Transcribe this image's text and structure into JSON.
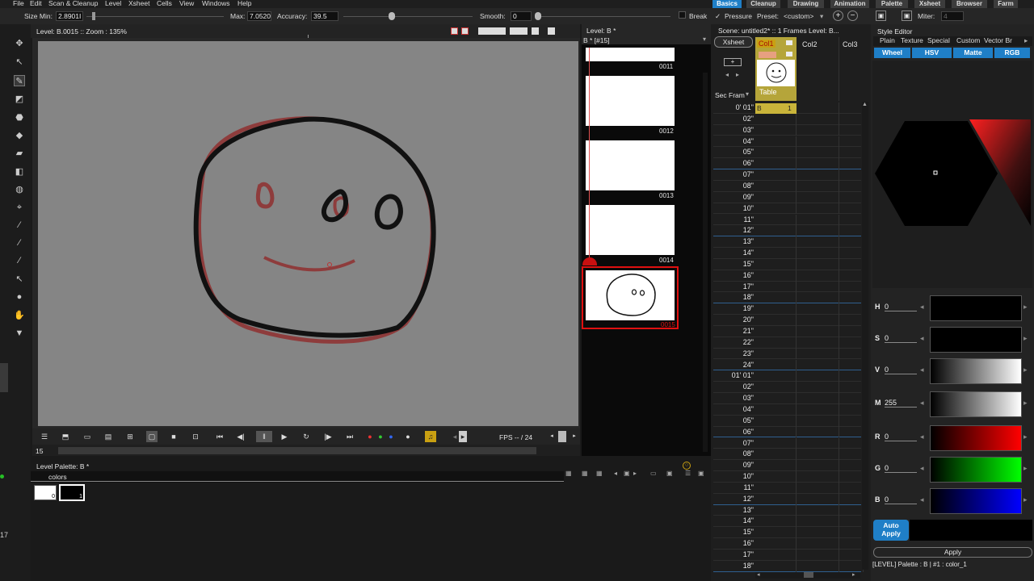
{
  "menu": [
    "File",
    "Edit",
    "Scan & Cleanup",
    "Level",
    "Xsheet",
    "Cells",
    "View",
    "Windows",
    "Help"
  ],
  "rooms": [
    "Basics",
    "Cleanup",
    "Drawing",
    "Animation",
    "Palette",
    "Xsheet",
    "Browser",
    "Farm"
  ],
  "active_room": "Basics",
  "tool_options": {
    "size_min_label": "Size Min:",
    "size_min_value": "2.8901I",
    "max_label": "Max:",
    "max_value": "7.0520",
    "accuracy_label": "Accuracy:",
    "accuracy_value": "39.5",
    "smooth_label": "Smooth:",
    "smooth_value": "0",
    "break_label": "Break",
    "pressure_label": "Pressure",
    "pressure_check": "✓",
    "preset_label": "Preset:",
    "preset_value": "<custom>",
    "miter_label": "Miter:",
    "miter_value": "4"
  },
  "viewer": {
    "header": "Level: B.0015  ::  Zoom : 135%",
    "frame_field": "15",
    "fps_label": "FPS -- / 24"
  },
  "level_strip": {
    "title": "Level:  B *",
    "subtitle": "B *  [#15]",
    "frames": [
      "0011",
      "0012",
      "0013",
      "0014",
      "0015"
    ]
  },
  "xsheet": {
    "scene": "Scene: untitled2*  ::  1 Frames  Level: B...",
    "tab": "Xsheet",
    "sec_frame": "Sec Fram",
    "columns": [
      "Col1",
      "Col2",
      "Col3"
    ],
    "table_label": "Table",
    "cell_level": "B",
    "cell_frame": "1",
    "rows": [
      "0' 01\"",
      "02\"",
      "03\"",
      "04\"",
      "05\"",
      "06\"",
      "07\"",
      "08\"",
      "09\"",
      "10\"",
      "11\"",
      "12\"",
      "13\"",
      "14\"",
      "15\"",
      "16\"",
      "17\"",
      "18\"",
      "19\"",
      "20\"",
      "21\"",
      "22\"",
      "23\"",
      "24\"",
      "01' 01\"",
      "02\"",
      "03\"",
      "04\"",
      "05\"",
      "06\"",
      "07\"",
      "08\"",
      "09\"",
      "10\"",
      "11\"",
      "12\"",
      "13\"",
      "14\"",
      "15\"",
      "16\"",
      "17\"",
      "18\""
    ]
  },
  "style_editor": {
    "title": "Style Editor",
    "tabs": [
      "Plain",
      "Texture",
      "Special",
      "Custom",
      "Vector Br"
    ],
    "modes": [
      "Wheel",
      "HSV",
      "Matte",
      "RGB"
    ],
    "channels": [
      {
        "label": "H",
        "value": "0"
      },
      {
        "label": "S",
        "value": "0"
      },
      {
        "label": "V",
        "value": "0"
      },
      {
        "label": "M",
        "value": "255"
      },
      {
        "label": "R",
        "value": "0"
      },
      {
        "label": "G",
        "value": "0"
      },
      {
        "label": "B",
        "value": "0"
      }
    ],
    "auto_apply": "Auto Apply",
    "apply": "Apply",
    "status": "[LEVEL]  Palette : B | #1 : color_1"
  },
  "palette": {
    "title": "Level Palette: B *",
    "page": "colors",
    "chips": [
      "0",
      "1"
    ]
  },
  "side_number": "17",
  "colors": {
    "accent": "#1f7fc7",
    "canvas": "#858585",
    "stroke_black": "#111111",
    "stroke_red": "#8e3c3c",
    "column_yellow": "#b5a53a",
    "selection_red": "#e01010"
  }
}
